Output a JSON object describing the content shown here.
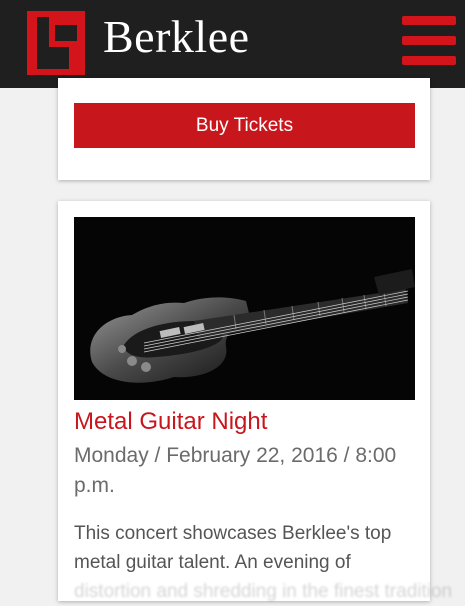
{
  "header": {
    "brand": "Berklee",
    "logo_icon": "berklee-logo-icon",
    "menu_icon": "hamburger-menu-icon",
    "accent_color": "#d3151b",
    "background_color": "#1f1f1f"
  },
  "tickets_card": {
    "buy_label": "Buy Tickets",
    "button_color": "#c8161d"
  },
  "event": {
    "image_icon": "electric-guitar-image",
    "title": "Metal Guitar Night",
    "date_line1": "Monday / February 22, 2016 / 8:00",
    "date_line2": "p.m.",
    "description_line1": "This concert showcases Berklee's top",
    "description_line2": "metal guitar talent. An evening of",
    "description_line3": "distortion and shredding in the finest tradition"
  }
}
